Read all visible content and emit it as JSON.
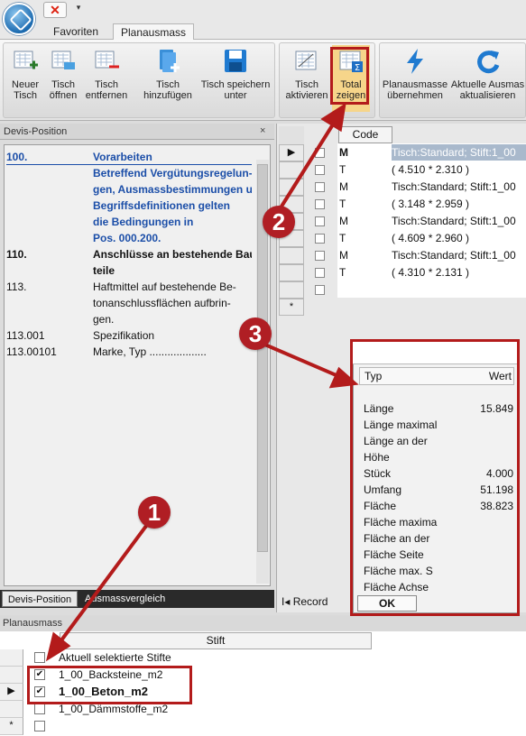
{
  "ribbon_tabs": {
    "favoriten": "Favoriten",
    "planausmass": "Planausmass"
  },
  "ribbon": {
    "neuer_tisch": "Neuer\nTisch",
    "tisch_oeffnen": "Tisch\nöffnen",
    "tisch_entfernen": "Tisch\nentfernen",
    "tisch_hinzufuegen": "Tisch\nhinzufügen",
    "tisch_speichern": "Tisch speichern\nunter",
    "tisch_aktivieren": "Tisch\naktivieren",
    "total_zeigen": "Total\nzeigen",
    "planausmasse_uebernehmen": "Planausmasse\nübernehmen",
    "aktuelle_ausmasse": "Aktuelle Ausmas\naktualisieren"
  },
  "devis": {
    "title": "Devis-Position",
    "close": "×",
    "rows": [
      {
        "num": "100.",
        "txt": "Vorarbeiten",
        "style": "blue"
      },
      {
        "num": "",
        "txt": "Betreffend Vergütungsregelun-",
        "style": "blue"
      },
      {
        "num": "",
        "txt": "gen, Ausmassbestimmungen u",
        "style": "blue"
      },
      {
        "num": "",
        "txt": "Begriffsdefinitionen gelten",
        "style": "blue"
      },
      {
        "num": "",
        "txt": "die Bedingungen in",
        "style": "blue"
      },
      {
        "num": "",
        "txt": "Pos. 000.200.",
        "style": "blue"
      },
      {
        "num": "110.",
        "txt": "Anschlüsse an bestehende Bau",
        "style": "bold"
      },
      {
        "num": "",
        "txt": "teile",
        "style": "bold"
      },
      {
        "num": "113.",
        "txt": "Haftmittel auf bestehende Be-",
        "style": "normal"
      },
      {
        "num": "",
        "txt": "tonanschlussflächen aufbrin-",
        "style": "normal"
      },
      {
        "num": "",
        "txt": "gen.",
        "style": "normal"
      },
      {
        "num": "113.001",
        "txt": "Spezifikation",
        "style": "normal"
      },
      {
        "num": "113.00101",
        "txt": "Marke, Typ ...................",
        "style": "normal"
      }
    ],
    "tab_devis": "Devis-Position",
    "tab_ausmass": "Ausmassvergleich"
  },
  "grid": {
    "code_header": "Code",
    "rows": [
      {
        "type": "M",
        "value": "Tisch:Standard; Stift:1_00",
        "selected": true
      },
      {
        "type": "T",
        "value": "(    4.510 *    2.310 )",
        "selected": false
      },
      {
        "type": "M",
        "value": "Tisch:Standard; Stift:1_00",
        "selected": false
      },
      {
        "type": "T",
        "value": "(    3.148 *    2.959 )",
        "selected": false
      },
      {
        "type": "M",
        "value": "Tisch:Standard; Stift:1_00",
        "selected": false
      },
      {
        "type": "T",
        "value": "(    4.609 *    2.960 )",
        "selected": false
      },
      {
        "type": "M",
        "value": "Tisch:Standard; Stift:1_00",
        "selected": false
      },
      {
        "type": "T",
        "value": "(    4.310 *    2.131 )",
        "selected": false
      }
    ],
    "record_label": "Record",
    "new_row_marker": "*"
  },
  "popup": {
    "col_typ": "Typ",
    "col_wert": "Wert",
    "rows": [
      {
        "k": "Länge",
        "v": "15.849"
      },
      {
        "k": "Länge maximal",
        "v": ""
      },
      {
        "k": "Länge an der",
        "v": ""
      },
      {
        "k": "Höhe",
        "v": ""
      },
      {
        "k": "Stück",
        "v": "4.000"
      },
      {
        "k": "Umfang",
        "v": "51.198"
      },
      {
        "k": "Fläche",
        "v": "38.823"
      },
      {
        "k": "Fläche maxima",
        "v": ""
      },
      {
        "k": "Fläche an der",
        "v": ""
      },
      {
        "k": "Fläche Seite",
        "v": ""
      },
      {
        "k": "Fläche max. S",
        "v": ""
      },
      {
        "k": "Fläche Achse",
        "v": ""
      }
    ],
    "ok": "OK"
  },
  "planausmass": {
    "title": "Planausmass",
    "col_stift": "Stift",
    "rows": [
      {
        "label": "Aktuell selektierte Stifte",
        "checked": false,
        "bold": false
      },
      {
        "label": "1_00_Backsteine_m2",
        "checked": true,
        "bold": false
      },
      {
        "label": "1_00_Beton_m2",
        "checked": true,
        "bold": true
      },
      {
        "label": "1_00_Dämmstoffe_m2",
        "checked": false,
        "bold": false
      }
    ]
  },
  "markers": {
    "one": "1",
    "two": "2",
    "three": "3"
  },
  "colors": {
    "annotation_red": "#b31b1b",
    "devis_blue": "#1b4ea8",
    "selection": "#a9b9cc"
  }
}
